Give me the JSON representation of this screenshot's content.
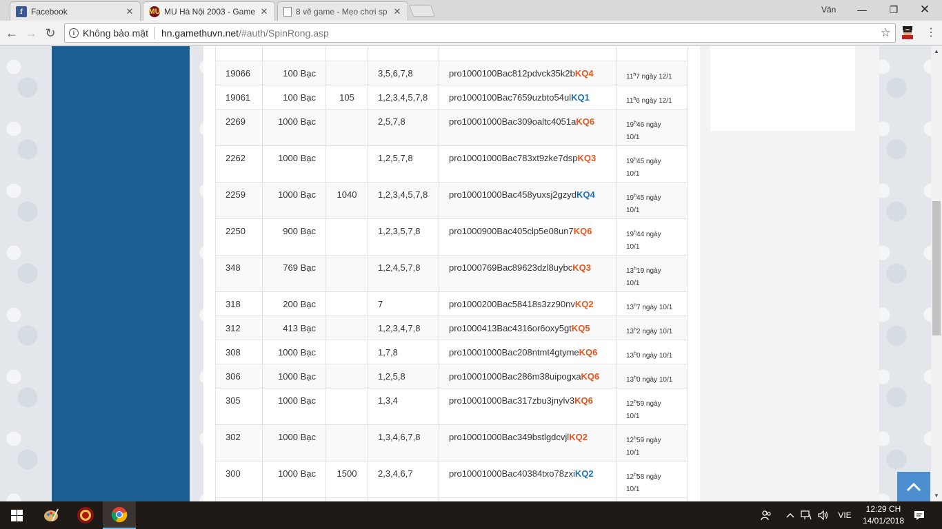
{
  "browser": {
    "tabs": [
      {
        "title": "Facebook",
        "icon": "facebook-icon",
        "active": false
      },
      {
        "title": "MU Hà Nội 2003 - Game",
        "icon": "mu-game-icon",
        "active": true
      },
      {
        "title": "8 vẽ game - Mẹo chơi sp",
        "icon": "document-icon",
        "active": false
      }
    ],
    "profile_name": "Văn",
    "security_label": "Không bảo mật",
    "url_host": "hn.gamethuvn.net",
    "url_path": "/#auth/SpinRong.asp"
  },
  "table": {
    "rows": [
      {
        "id": "19066",
        "amount": "100 Bạc",
        "extra": "",
        "numbers": "3,5,6,7,8",
        "code": "pro1000100Bac812pdvck35k2b",
        "result": "KQ4",
        "result_color": "red",
        "time_h": "11",
        "time_rest": "7 ngày 12/1",
        "time_date": "",
        "tall": false
      },
      {
        "id": "19061",
        "amount": "100 Bạc",
        "extra": "105",
        "numbers": "1,2,3,4,5,7,8",
        "code": "pro1000100Bac7659uzbto54ul",
        "result": "KQ1",
        "result_color": "blue",
        "time_h": "11",
        "time_rest": "6 ngày 12/1",
        "time_date": "",
        "tall": false
      },
      {
        "id": "2269",
        "amount": "1000 Bạc",
        "extra": "",
        "numbers": "2,5,7,8",
        "code": "pro10001000Bac309oaltc4051a",
        "result": "KQ6",
        "result_color": "red",
        "time_h": "19",
        "time_rest": "46 ngày",
        "time_date": "10/1",
        "tall": true
      },
      {
        "id": "2262",
        "amount": "1000 Bạc",
        "extra": "",
        "numbers": "1,2,5,7,8",
        "code": "pro10001000Bac783xt9zke7dsp",
        "result": "KQ3",
        "result_color": "red",
        "time_h": "19",
        "time_rest": "45 ngày",
        "time_date": "10/1",
        "tall": true
      },
      {
        "id": "2259",
        "amount": "1000 Bạc",
        "extra": "1040",
        "numbers": "1,2,3,4,5,7,8",
        "code": "pro10001000Bac458yuxsj2gzyd",
        "result": "KQ4",
        "result_color": "blue",
        "time_h": "19",
        "time_rest": "45 ngày",
        "time_date": "10/1",
        "tall": true
      },
      {
        "id": "2250",
        "amount": "900 Bạc",
        "extra": "",
        "numbers": "1,2,3,5,7,8",
        "code": "pro1000900Bac405clp5e08un7",
        "result": "KQ6",
        "result_color": "red",
        "time_h": "19",
        "time_rest": "44 ngày",
        "time_date": "10/1",
        "tall": true
      },
      {
        "id": "348",
        "amount": "769 Bạc",
        "extra": "",
        "numbers": "1,2,4,5,7,8",
        "code": "pro1000769Bac89623dzl8uybc",
        "result": "KQ3",
        "result_color": "red",
        "time_h": "13",
        "time_rest": "19 ngày",
        "time_date": "10/1",
        "tall": true
      },
      {
        "id": "318",
        "amount": "200 Bạc",
        "extra": "",
        "numbers": "7",
        "code": "pro1000200Bac58418s3zz90nv",
        "result": "KQ2",
        "result_color": "red",
        "time_h": "13",
        "time_rest": "7 ngày 10/1",
        "time_date": "",
        "tall": false
      },
      {
        "id": "312",
        "amount": "413 Bạc",
        "extra": "",
        "numbers": "1,2,3,4,7,8",
        "code": "pro1000413Bac4316or6oxy5gt",
        "result": "KQ5",
        "result_color": "red",
        "time_h": "13",
        "time_rest": "2 ngày 10/1",
        "time_date": "",
        "tall": false
      },
      {
        "id": "308",
        "amount": "1000 Bạc",
        "extra": "",
        "numbers": "1,7,8",
        "code": "pro10001000Bac208ntmt4gtyme",
        "result": "KQ6",
        "result_color": "red",
        "time_h": "13",
        "time_rest": "0 ngày 10/1",
        "time_date": "",
        "tall": false
      },
      {
        "id": "306",
        "amount": "1000 Bạc",
        "extra": "",
        "numbers": "1,2,5,8",
        "code": "pro10001000Bac286m38uipogxa",
        "result": "KQ6",
        "result_color": "red",
        "time_h": "13",
        "time_rest": "0 ngày 10/1",
        "time_date": "",
        "tall": false
      },
      {
        "id": "305",
        "amount": "1000 Bạc",
        "extra": "",
        "numbers": "1,3,4",
        "code": "pro10001000Bac317zbu3jnylv3",
        "result": "KQ6",
        "result_color": "red",
        "time_h": "12",
        "time_rest": "59 ngày",
        "time_date": "10/1",
        "tall": true
      },
      {
        "id": "302",
        "amount": "1000 Bạc",
        "extra": "",
        "numbers": "1,3,4,6,7,8",
        "code": "pro10001000Bac349bstlgdcvjl",
        "result": "KQ2",
        "result_color": "red",
        "time_h": "12",
        "time_rest": "59 ngày",
        "time_date": "10/1",
        "tall": true
      },
      {
        "id": "300",
        "amount": "1000 Bạc",
        "extra": "1500",
        "numbers": "2,3,4,6,7",
        "code": "pro10001000Bac40384txo78zxi",
        "result": "KQ2",
        "result_color": "blue",
        "time_h": "12",
        "time_rest": "58 ngày",
        "time_date": "10/1",
        "tall": true
      }
    ]
  },
  "colors": {
    "result_red": "#e8541c",
    "result_blue": "#1d72b8",
    "sidebar_blue": "#1c5f95",
    "scroll_top_button": "#4d8ed0"
  },
  "taskbar": {
    "language": "VIE",
    "time": "12:29 CH",
    "date": "14/01/2018"
  }
}
